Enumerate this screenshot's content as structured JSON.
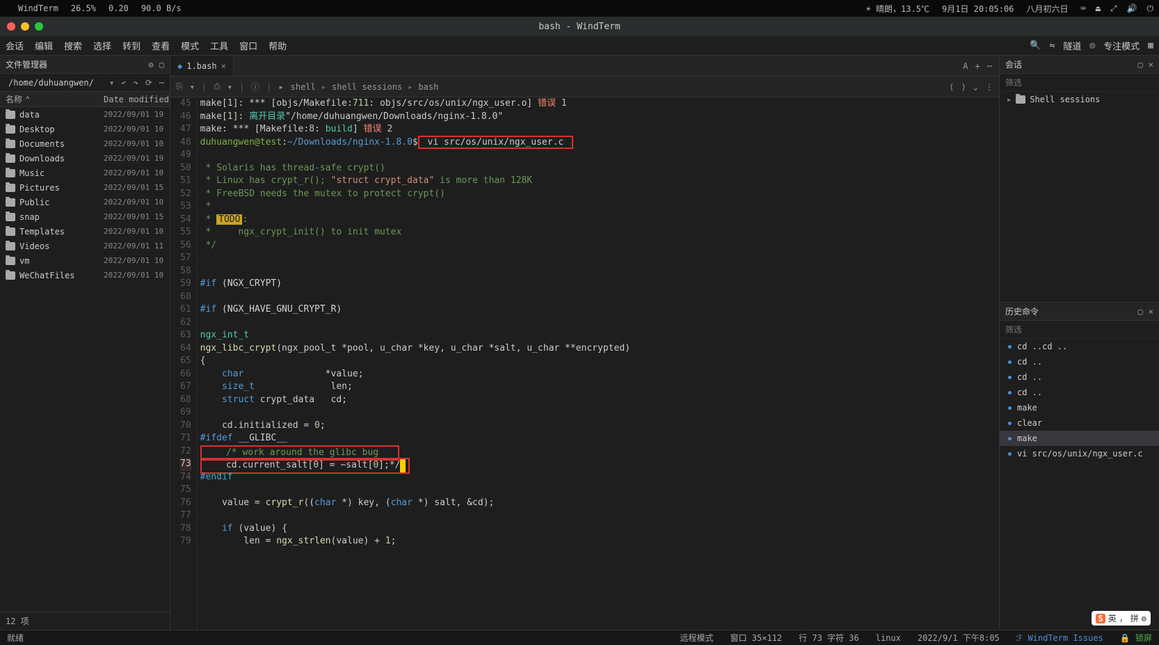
{
  "menubar": {
    "app": "WindTerm",
    "cpu": "26.5%",
    "load": "0.20",
    "net": "90.0 B/s",
    "weather": "☀ 晴朗，13.5℃",
    "datetime": "9月1日 20:05:06",
    "lunar": "八月初六日"
  },
  "window": {
    "title": "bash - WindTerm"
  },
  "appmenu": {
    "items": [
      "会话",
      "编辑",
      "搜索",
      "选择",
      "转到",
      "查看",
      "模式",
      "工具",
      "窗口",
      "帮助"
    ],
    "tunnel": "隧道",
    "focus": "专注模式"
  },
  "filepanel": {
    "title": "文件管理器",
    "path": "/home/duhuangwen/",
    "col_name": "名称",
    "col_date": "Date modified",
    "items": [
      {
        "name": "data",
        "date": "2022/09/01 19"
      },
      {
        "name": "Desktop",
        "date": "2022/09/01 10"
      },
      {
        "name": "Documents",
        "date": "2022/09/01 10"
      },
      {
        "name": "Downloads",
        "date": "2022/09/01 19"
      },
      {
        "name": "Music",
        "date": "2022/09/01 10"
      },
      {
        "name": "Pictures",
        "date": "2022/09/01 15"
      },
      {
        "name": "Public",
        "date": "2022/09/01 10"
      },
      {
        "name": "snap",
        "date": "2022/09/01 15"
      },
      {
        "name": "Templates",
        "date": "2022/09/01 10"
      },
      {
        "name": "Videos",
        "date": "2022/09/01 11"
      },
      {
        "name": "vm",
        "date": "2022/09/01 10"
      },
      {
        "name": "WeChatFiles",
        "date": "2022/09/01 10"
      }
    ],
    "footer": "12 项"
  },
  "tabs": {
    "active": "1.bash"
  },
  "toolbar": {
    "breadcrumb": [
      "shell",
      "shell sessions",
      "bash"
    ]
  },
  "terminal": {
    "lines": [
      {
        "n": 45,
        "html": "make[<span class='num'>1</span>]: *** [objs/Makefile:<span class='num'>711</span>: objs/src/os/unix/ngx_user.o] <span class='err'>错误</span> <span class='num'>1</span>"
      },
      {
        "n": 46,
        "html": "make[<span class='num'>1</span>]: <span class='id'>离开目录</span>\"/home/duhuangwen/Downloads/nginx-1.8.0\""
      },
      {
        "n": 47,
        "html": "make: *** [Makefile:<span class='num'>8</span>: <span class='id'>build</span>] <span class='err'>错误</span> <span class='num'>2</span>"
      },
      {
        "n": 48,
        "html": "<span class='prompt-user'>duhuangwen@test</span>:<span class='prompt-path'>~/Downloads/nginx-1.8.0</span>$<span class='redbox'> vi src/os/unix/ngx_user.c </span>"
      },
      {
        "n": 49,
        "html": ""
      },
      {
        "n": 50,
        "html": " <span class='cm'>* Solaris has thread-safe crypt()</span>"
      },
      {
        "n": 51,
        "html": " <span class='cm'>* Linux has crypt_r();</span> <span class='str'>\"struct crypt_data\"</span> <span class='cm'>is more than 128K</span>"
      },
      {
        "n": 52,
        "html": " <span class='cm'>* FreeBSD needs the mutex to protect crypt()</span>"
      },
      {
        "n": 53,
        "html": " <span class='cm'>*</span>"
      },
      {
        "n": 54,
        "html": " <span class='cm'>*</span> <span class='todo-hl'>TODO</span><span class='cm'>:</span>"
      },
      {
        "n": 55,
        "html": " <span class='cm'>*     ngx_crypt_init() to init mutex</span>"
      },
      {
        "n": 56,
        "html": " <span class='cm'>*/</span>"
      },
      {
        "n": 57,
        "html": ""
      },
      {
        "n": 58,
        "html": ""
      },
      {
        "n": 59,
        "html": "<span class='kw'>#if</span> <span class='op'>(NGX_CRYPT)</span>"
      },
      {
        "n": 60,
        "html": ""
      },
      {
        "n": 61,
        "html": "<span class='kw'>#if</span> <span class='op'>(NGX_HAVE_GNU_CRYPT_R)</span>"
      },
      {
        "n": 62,
        "html": ""
      },
      {
        "n": 63,
        "html": "<span class='id'>ngx_int_t</span>"
      },
      {
        "n": 64,
        "html": "<span class='fn'>ngx_libc_crypt</span>(ngx_pool_t *pool, u_char *key, u_char *salt, u_char **encrypted)"
      },
      {
        "n": 65,
        "html": "{"
      },
      {
        "n": 66,
        "html": "    <span class='kw'>char</span>               *value;"
      },
      {
        "n": 67,
        "html": "    <span class='kw'>size_t</span>              len;"
      },
      {
        "n": 68,
        "html": "    <span class='kw'>struct</span> crypt_data   cd;"
      },
      {
        "n": 69,
        "html": ""
      },
      {
        "n": 70,
        "html": "    cd.initialized = <span class='num'>0</span>;"
      },
      {
        "n": 71,
        "html": "<span class='kw'>#ifdef</span> __GLIBC__"
      },
      {
        "n": 72,
        "html": "<span class='redbox-wrap'>    <span class='cm'>/* work around the glibc bug</span>   </span>"
      },
      {
        "n": 73,
        "hl": true,
        "html": "<span class='redbox-wrap'>    cd.current_salt[<span class='num'>0</span>] = ~salt[<span class='num'>0</span>];*/<span class='cursor'>&nbsp;</span></span>"
      },
      {
        "n": 74,
        "html": "<span class='kw'>#endif</span>"
      },
      {
        "n": 75,
        "html": ""
      },
      {
        "n": 76,
        "html": "    value = <span class='fn'>crypt_r</span>((<span class='kw'>char</span> *) key, (<span class='kw'>char</span> *) salt, &cd);"
      },
      {
        "n": 77,
        "html": ""
      },
      {
        "n": 78,
        "html": "    <span class='kw'>if</span> (value) {"
      },
      {
        "n": 79,
        "html": "        len = <span class='fn'>ngx_strlen</span>(value) + <span class='num'>1</span>;"
      }
    ]
  },
  "sessions_panel": {
    "title": "会话",
    "filter": "筛选",
    "tree_root": "Shell sessions"
  },
  "history_panel": {
    "title": "历史命令",
    "filter": "筛选",
    "items": [
      "cd ..cd ..",
      "cd ..",
      "cd ..",
      "cd ..",
      "make",
      "clear",
      "make",
      "vi src/os/unix/ngx_user.c"
    ],
    "selected_index": 6
  },
  "statusbar": {
    "ready": "就绪",
    "mode": "远程模式",
    "window": "窗口 35×112",
    "cursor": "行 73 字符 36",
    "os": "linux",
    "time": "2022/9/1 下午8:05",
    "issues": "WindTerm Issues",
    "lock": "锁屏"
  },
  "ime": {
    "brand": "S",
    "lang": "英",
    "mode": "拼"
  }
}
